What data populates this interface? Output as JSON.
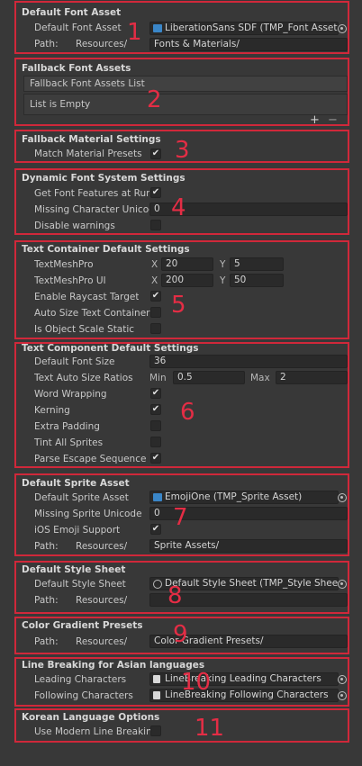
{
  "default_font_asset": {
    "header": "Default Font Asset",
    "font_label": "Default Font Asset",
    "font_value": "LiberationSans SDF (TMP_Font Asset)",
    "path_label": "Path:",
    "path_prefix": "Resources/",
    "path_value": "Fonts & Materials/"
  },
  "fallback_font_assets": {
    "header": "Fallback Font Assets",
    "list_title": "Fallback Font Assets List",
    "empty_text": "List is Empty",
    "add_label": "+",
    "remove_label": "−"
  },
  "fallback_material": {
    "header": "Fallback Material Settings",
    "match_label": "Match Material Presets",
    "match_checked": true
  },
  "dynamic_font": {
    "header": "Dynamic Font System Settings",
    "get_features_label": "Get Font Features at Runtime",
    "get_features_checked": true,
    "missing_char_label": "Missing Character Unicode",
    "missing_char_value": "0",
    "disable_warnings_label": "Disable warnings",
    "disable_warnings_checked": false
  },
  "text_container": {
    "header": "Text Container Default Settings",
    "tmp_label": "TextMeshPro",
    "tmp_x": "20",
    "tmp_y": "5",
    "tmpui_label": "TextMeshPro UI",
    "tmpui_x": "200",
    "tmpui_y": "50",
    "x_label": "X",
    "y_label": "Y",
    "raycast_label": "Enable Raycast Target",
    "raycast_checked": true,
    "autosize_label": "Auto Size Text Container",
    "autosize_checked": false,
    "objscale_label": "Is Object Scale Static",
    "objscale_checked": false
  },
  "text_component": {
    "header": "Text Component Default Settings",
    "font_size_label": "Default Font Size",
    "font_size_value": "36",
    "ratios_label": "Text Auto Size Ratios",
    "min_label": "Min",
    "min_value": "0.5",
    "max_label": "Max",
    "max_value": "2",
    "word_wrap_label": "Word Wrapping",
    "word_wrap_checked": true,
    "kerning_label": "Kerning",
    "kerning_checked": true,
    "extra_padding_label": "Extra Padding",
    "extra_padding_checked": false,
    "tint_label": "Tint All Sprites",
    "tint_checked": false,
    "parse_label": "Parse Escape Sequence",
    "parse_checked": true
  },
  "default_sprite": {
    "header": "Default Sprite Asset",
    "sprite_label": "Default Sprite Asset",
    "sprite_value": "EmojiOne (TMP_Sprite Asset)",
    "missing_label": "Missing Sprite Unicode",
    "missing_value": "0",
    "ios_label": "iOS Emoji Support",
    "ios_checked": true,
    "path_label": "Path:",
    "path_prefix": "Resources/",
    "path_value": "Sprite Assets/"
  },
  "default_style": {
    "header": "Default Style Sheet",
    "style_label": "Default Style Sheet",
    "style_value": "Default Style Sheet (TMP_Style Sheet)",
    "path_label": "Path:",
    "path_prefix": "Resources/",
    "path_value": ""
  },
  "color_gradient": {
    "header": "Color Gradient Presets",
    "path_label": "Path:",
    "path_prefix": "Resources/",
    "path_value": "Color Gradient Presets/"
  },
  "line_breaking": {
    "header": "Line Breaking for Asian languages",
    "leading_label": "Leading Characters",
    "leading_value": "LineBreaking Leading Characters",
    "following_label": "Following Characters",
    "following_value": "LineBreaking Following Characters"
  },
  "korean": {
    "header": "Korean Language Options",
    "modern_label": "Use Modern Line Breaking",
    "modern_checked": false
  },
  "annotations": [
    "1",
    "2",
    "3",
    "4",
    "5",
    "6",
    "7",
    "8",
    "9",
    "10",
    "11"
  ],
  "check_glyph": "✔",
  "colors": {
    "annotation_red": "#e42d45",
    "frame_red": "#d0283a",
    "font_asset_icon": "#3a86c8",
    "sprite_icon": "#3a86c8",
    "text_asset_icon": "#d8d8d8"
  }
}
